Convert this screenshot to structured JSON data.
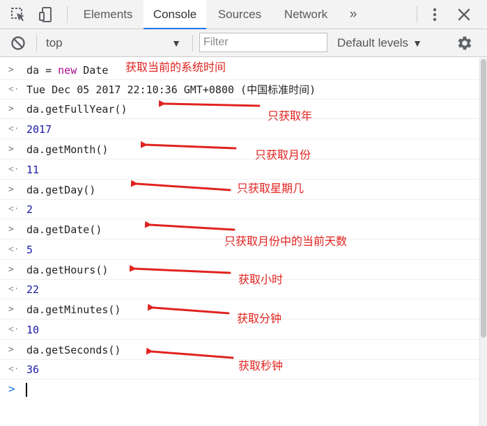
{
  "tabs": {
    "elements": "Elements",
    "console": "Console",
    "sources": "Sources",
    "network": "Network",
    "more": "»"
  },
  "filterbar": {
    "context": "top",
    "filter_placeholder": "Filter",
    "levels": "Default levels"
  },
  "console": {
    "rows": [
      {
        "kind": "input",
        "text": "da = new Date"
      },
      {
        "kind": "result",
        "text": "Tue Dec 05 2017 22:10:36 GMT+0800 (中国标准时间)"
      },
      {
        "kind": "input",
        "text": "da.getFullYear()"
      },
      {
        "kind": "result",
        "text": "2017"
      },
      {
        "kind": "input",
        "text": "da.getMonth()"
      },
      {
        "kind": "result",
        "text": "11"
      },
      {
        "kind": "input",
        "text": "da.getDay()"
      },
      {
        "kind": "result",
        "text": "2"
      },
      {
        "kind": "input",
        "text": "da.getDate()"
      },
      {
        "kind": "result",
        "text": "5"
      },
      {
        "kind": "input",
        "text": "da.getHours()"
      },
      {
        "kind": "result",
        "text": "22"
      },
      {
        "kind": "input",
        "text": "da.getMinutes()"
      },
      {
        "kind": "result",
        "text": "10"
      },
      {
        "kind": "input",
        "text": "da.getSeconds()"
      },
      {
        "kind": "result",
        "text": "36"
      }
    ],
    "assign_var": "da",
    "assign_op": " = ",
    "assign_kw": "new",
    "assign_rest": " Date"
  },
  "annotations": {
    "now": "获取当前的系统时间",
    "year": "只获取年",
    "month": "只获取月份",
    "weekday": "只获取星期几",
    "date": "只获取月份中的当前天数",
    "hours": "获取小时",
    "minutes": "获取分钟",
    "seconds": "获取秒钟"
  },
  "colors": {
    "accent": "#1a73e8",
    "annotation": "#e0231f",
    "keyword": "#aa0d91",
    "number": "#1a1aa6"
  },
  "icons": {
    "inspect": "inspect-element-icon",
    "device": "device-toolbar-icon",
    "more": "kebab-menu-icon",
    "close": "close-icon",
    "clear": "clear-console-icon",
    "settings": "gear-icon"
  }
}
